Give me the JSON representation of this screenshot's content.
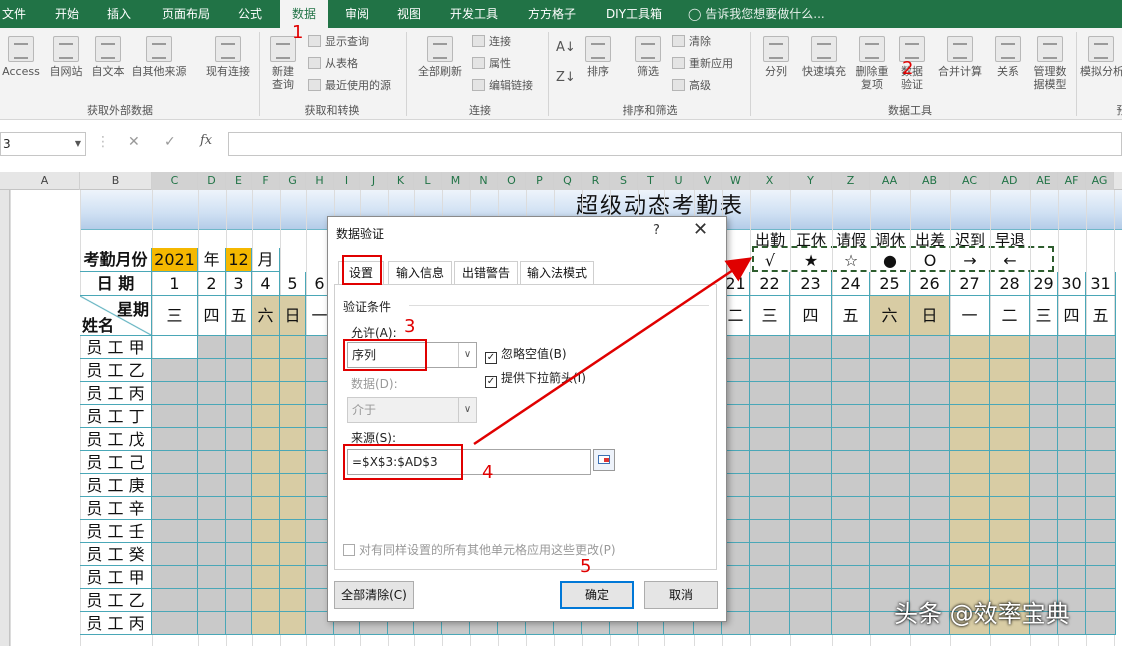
{
  "menu": {
    "tabs": [
      "文件",
      "开始",
      "插入",
      "页面布局",
      "公式",
      "数据",
      "审阅",
      "视图",
      "开发工具",
      "方方格子",
      "DIY工具箱"
    ],
    "tell_me": "告诉我您想要做什么..."
  },
  "ribbon": {
    "get_external": {
      "label": "获取外部数据",
      "items": [
        "Access",
        "自网站",
        "自文本",
        "自其他来源",
        "现有连接"
      ]
    },
    "get_transform": {
      "label": "获取和转换",
      "new_query": "新建查询",
      "small": [
        "显示查询",
        "从表格",
        "最近使用的源"
      ]
    },
    "connections": {
      "label": "连接",
      "refresh_all": "全部刷新",
      "small": [
        "连接",
        "属性",
        "编辑链接"
      ]
    },
    "sort_filter": {
      "label": "排序和筛选",
      "sort": "排序",
      "filter": "筛选",
      "small": [
        "清除",
        "重新应用",
        "高级"
      ]
    },
    "data_tools": {
      "label": "数据工具",
      "items": [
        "分列",
        "快速填充",
        "删除重复项",
        "数据验证",
        "合并计算",
        "关系",
        "管理数据模型"
      ]
    },
    "forecast": {
      "items": [
        "模拟分析",
        "预"
      ]
    }
  },
  "formula_bar": {
    "name_box": "3",
    "fx": "fx",
    "value": ""
  },
  "columns": [
    "A",
    "B",
    "C",
    "D",
    "E",
    "F",
    "G",
    "H",
    "I",
    "J",
    "K",
    "L",
    "M",
    "N",
    "O",
    "P",
    "Q",
    "R",
    "S",
    "T",
    "U",
    "V",
    "W",
    "X",
    "Y",
    "Z",
    "AA",
    "AB",
    "AC",
    "AD",
    "AE",
    "AF",
    "AG"
  ],
  "sheet": {
    "title": "超级动态考勤表",
    "month_label": "考勤月份",
    "year": "2021",
    "year_unit": "年",
    "month": "12",
    "month_unit": "月",
    "date_label": "日 期",
    "weekday_label": "星期",
    "name_label": "姓名",
    "legend_names": [
      "出勤",
      "正休",
      "请假",
      "调休",
      "出差",
      "迟到",
      "早退"
    ],
    "legend_symbols": [
      "√",
      "★",
      "☆",
      "●",
      "O",
      "→",
      "←"
    ],
    "days_left": [
      "1",
      "2",
      "3",
      "4",
      "5",
      "6"
    ],
    "days_right": [
      "21",
      "22",
      "23",
      "24",
      "25",
      "26",
      "27",
      "28",
      "29",
      "30",
      "31"
    ],
    "weekdays_left": [
      "三",
      "四",
      "五",
      "六",
      "日",
      "一"
    ],
    "weekdays_right": [
      "二",
      "三",
      "四",
      "五",
      "六",
      "日",
      "一",
      "二",
      "三",
      "四",
      "五"
    ],
    "employees": [
      "员 工 甲",
      "员 工 乙",
      "员 工 丙",
      "员 工 丁",
      "员 工 戊",
      "员 工 己",
      "员 工 庚",
      "员 工 辛",
      "员 工 壬",
      "员 工 癸",
      "员 工 甲",
      "员 工 乙",
      "员 工 丙"
    ]
  },
  "dialog": {
    "title": "数据验证",
    "help": "?",
    "close": "✕",
    "tabs": [
      "设置",
      "输入信息",
      "出错警告",
      "输入法模式"
    ],
    "criteria_label": "验证条件",
    "allow_label": "允许(A):",
    "allow_value": "序列",
    "ignore_blank": "忽略空值(B)",
    "dropdown": "提供下拉箭头(I)",
    "data_label": "数据(D):",
    "data_value": "介于",
    "source_label": "来源(S):",
    "source_value": "=$X$3:$AD$3",
    "apply_all": "对有同样设置的所有其他单元格应用这些更改(P)",
    "clear_all": "全部清除(C)",
    "ok": "确定",
    "cancel": "取消"
  },
  "annotations": [
    "1",
    "2",
    "3",
    "4",
    "5"
  ],
  "watermark": "头条 @效率宝典",
  "colors": {
    "excel_green": "#217346",
    "annotation_red": "#e00000",
    "year_fill": "#f5b800",
    "weekend_fill": "#d8cca4",
    "grid_fill": "#c9c9c9",
    "table_border": "#4aa7b7"
  }
}
